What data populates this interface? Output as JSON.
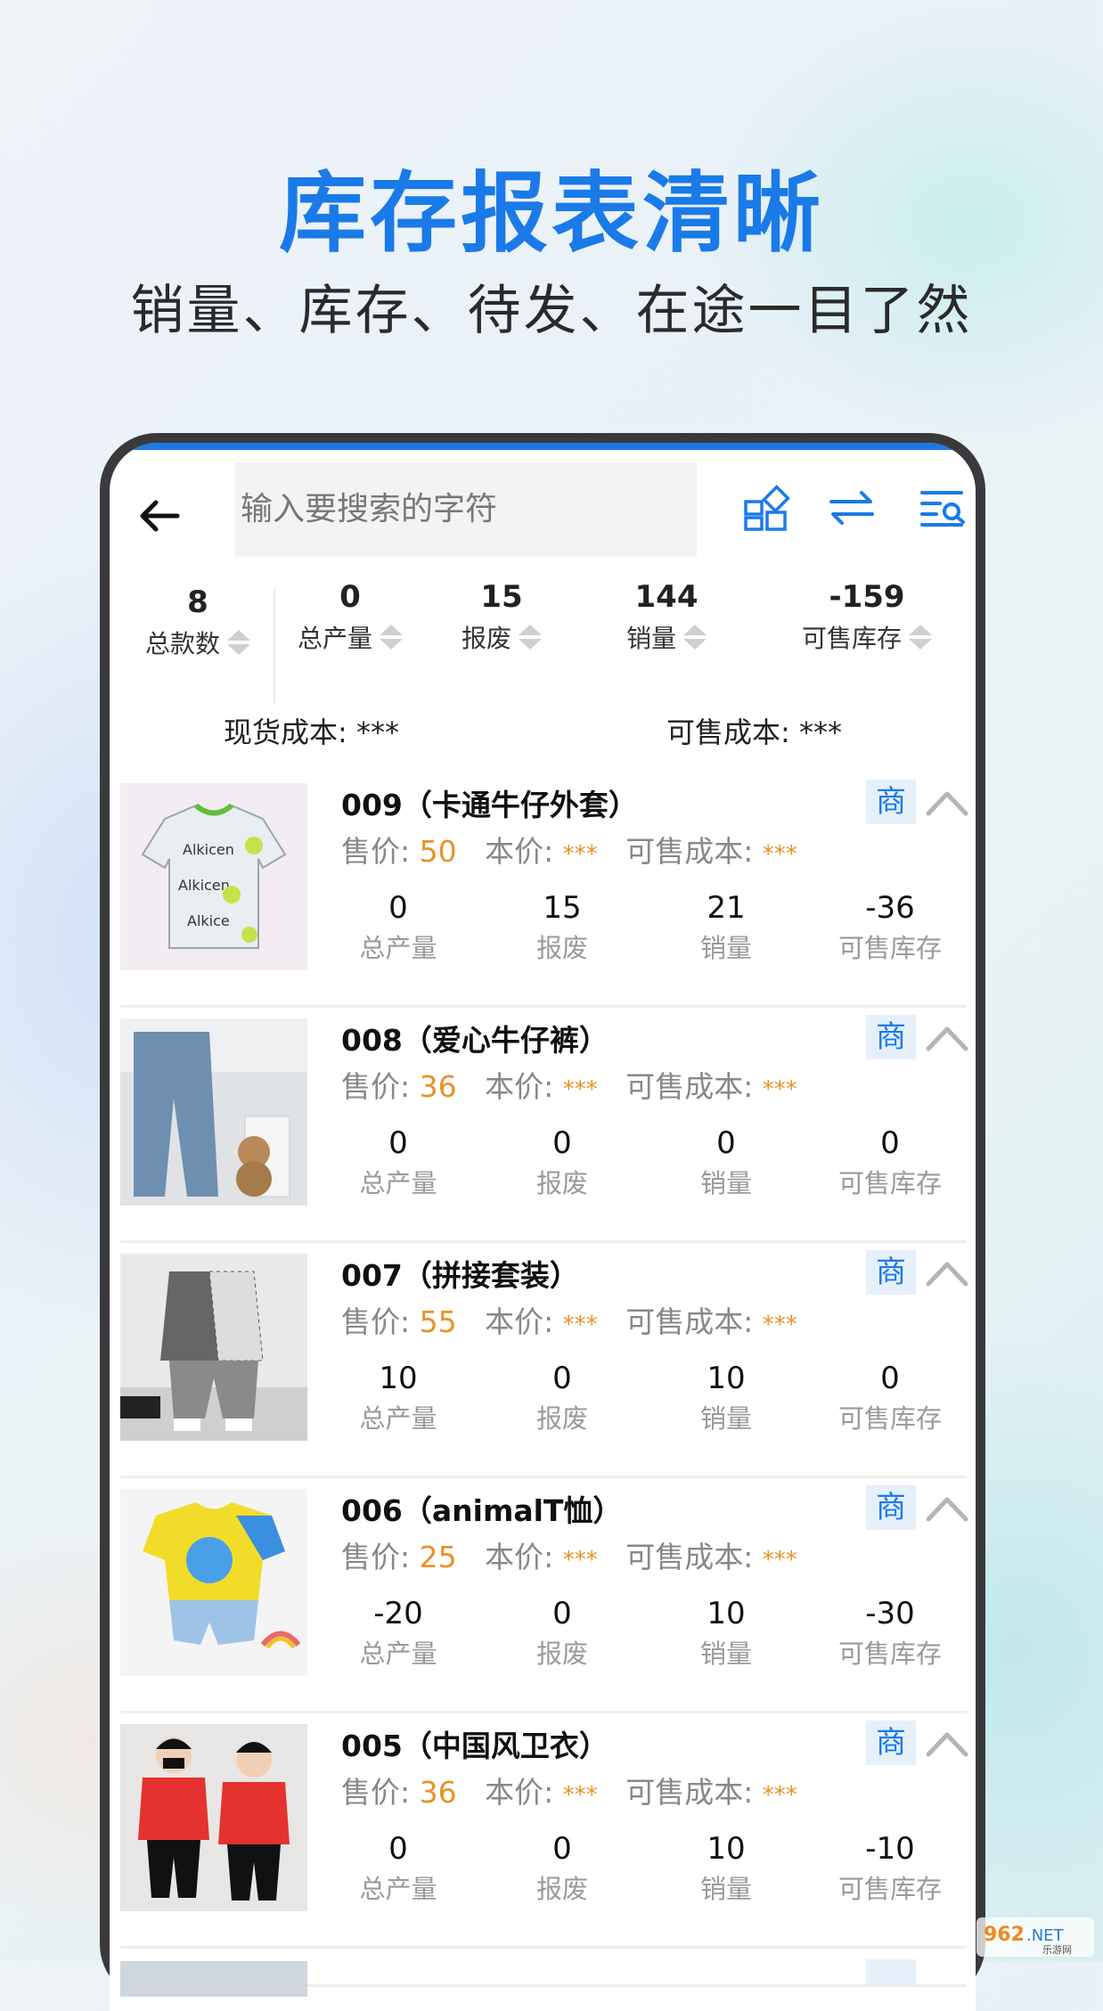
{
  "hero": {
    "title": "库存报表清晰",
    "subtitle": "销量、库存、待发、在途一目了然"
  },
  "colors": {
    "accent": "#1a7ae8",
    "price": "#e8922a",
    "muted": "#9a9a9a"
  },
  "toolbar": {
    "back_icon": "arrow-left-icon",
    "search_placeholder": "输入要搜索的字符",
    "icons": [
      "grid-layout-icon",
      "swap-arrows-icon",
      "list-search-icon"
    ]
  },
  "summary": [
    {
      "value": "8",
      "label": "总款数"
    },
    {
      "value": "0",
      "label": "总产量"
    },
    {
      "value": "15",
      "label": "报废"
    },
    {
      "value": "144",
      "label": "销量"
    },
    {
      "value": "-159",
      "label": "可售库存"
    }
  ],
  "costs": {
    "stock_cost": "现货成本: ***",
    "sellable_cost": "可售成本: ***"
  },
  "labels": {
    "price": "售价: ",
    "cost": "本价: ",
    "sellable_cost": "可售成本: ",
    "hidden": "***",
    "badge": "商",
    "m_output": "总产量",
    "m_scrap": "报废",
    "m_sales": "销量",
    "m_stock": "可售库存"
  },
  "products": [
    {
      "title": "009（卡通牛仔外套）",
      "price": "50",
      "output": "0",
      "scrap": "15",
      "sales": "21",
      "stock": "-36"
    },
    {
      "title": "008（爱心牛仔裤）",
      "price": "36",
      "output": "0",
      "scrap": "0",
      "sales": "0",
      "stock": "0"
    },
    {
      "title": "007（拼接套装）",
      "price": "55",
      "output": "10",
      "scrap": "0",
      "sales": "10",
      "stock": "0"
    },
    {
      "title": "006（animalT恤）",
      "price": "25",
      "output": "-20",
      "scrap": "0",
      "sales": "10",
      "stock": "-30"
    },
    {
      "title": "005（中国风卫衣）",
      "price": "36",
      "output": "0",
      "scrap": "0",
      "sales": "10",
      "stock": "-10"
    }
  ],
  "watermark": {
    "text": "962.NET",
    "sub": "乐游网"
  }
}
